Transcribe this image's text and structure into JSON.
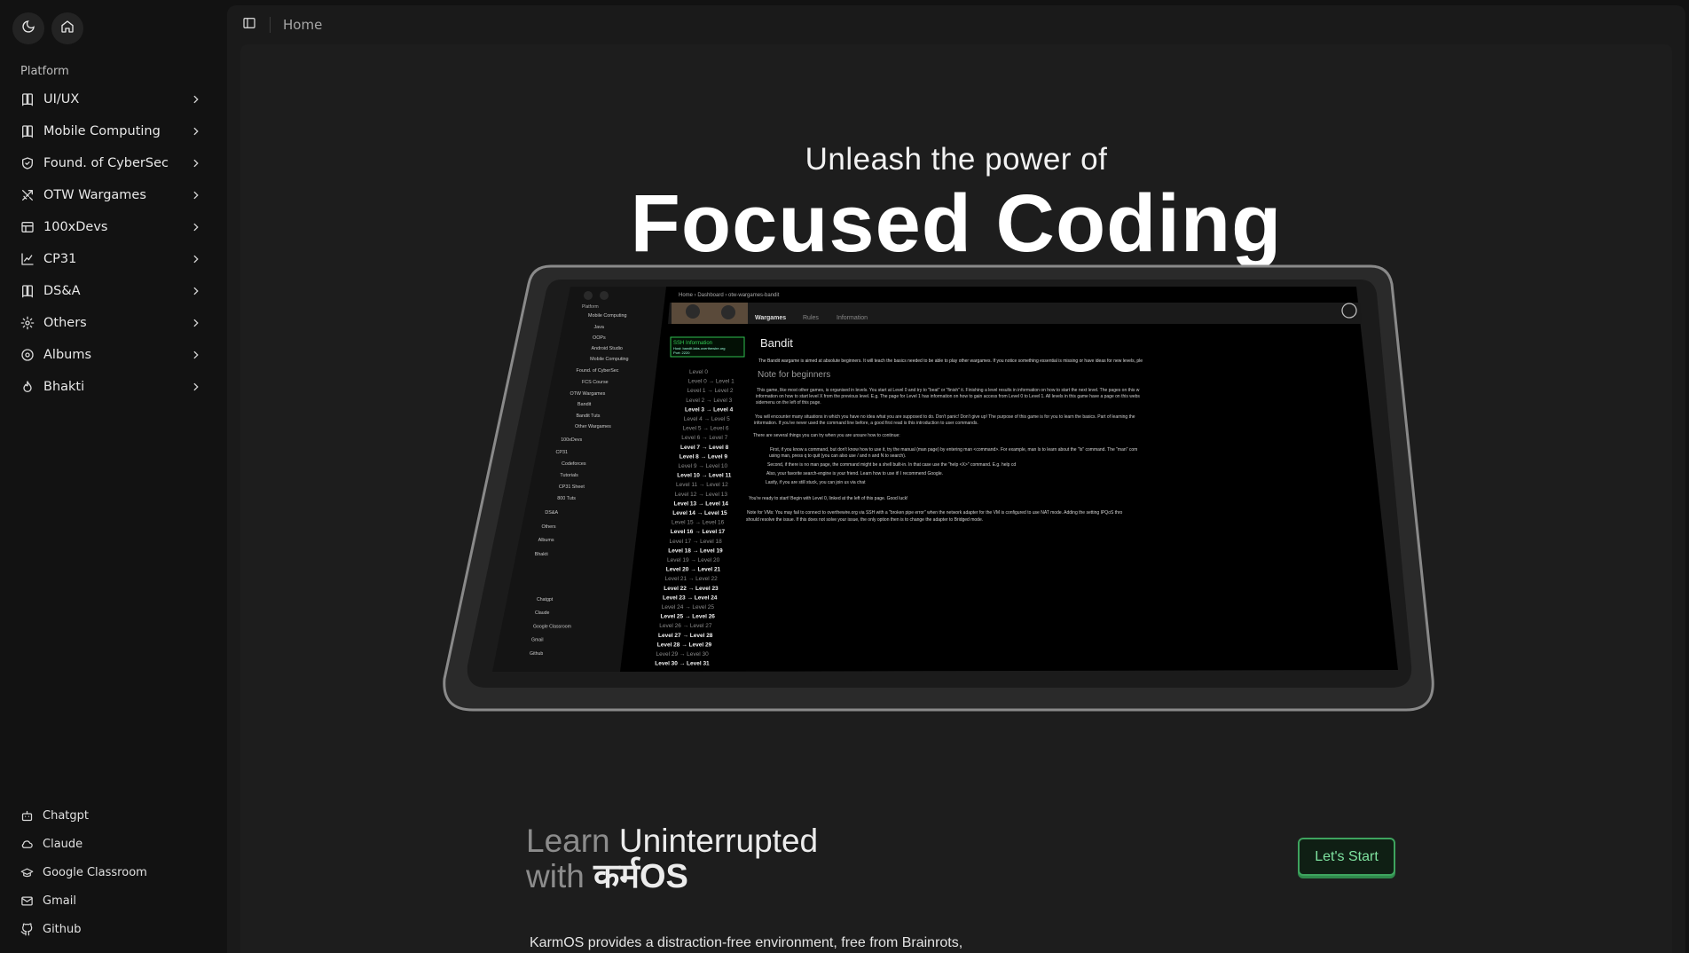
{
  "top_buttons": [
    {
      "icon": "moon-icon"
    },
    {
      "icon": "home-icon"
    }
  ],
  "sidebar": {
    "section_label": "Platform",
    "items": [
      {
        "label": "UI/UX",
        "icon": "book-icon"
      },
      {
        "label": "Mobile Computing",
        "icon": "book-icon"
      },
      {
        "label": "Found. of CyberSec",
        "icon": "shield-icon"
      },
      {
        "label": "OTW Wargames",
        "icon": "swords-icon"
      },
      {
        "label": "100xDevs",
        "icon": "table-icon"
      },
      {
        "label": "CP31",
        "icon": "chart-icon"
      },
      {
        "label": "DS&A",
        "icon": "book-icon"
      },
      {
        "label": "Others",
        "icon": "gear-icon"
      },
      {
        "label": "Albums",
        "icon": "disc-icon"
      },
      {
        "label": "Bhakti",
        "icon": "flame-icon"
      }
    ],
    "bottom_links": [
      {
        "label": "Chatgpt",
        "icon": "bot-icon"
      },
      {
        "label": "Claude",
        "icon": "cloud-icon"
      },
      {
        "label": "Google Classroom",
        "icon": "graduation-cap-icon"
      },
      {
        "label": "Gmail",
        "icon": "mail-icon"
      },
      {
        "label": "Github",
        "icon": "github-icon"
      }
    ]
  },
  "header": {
    "breadcrumb": "Home"
  },
  "hero": {
    "subtitle": "Unleash the power of",
    "title": "Focused Coding"
  },
  "preview": {
    "breadcrumb": [
      "Home",
      "Dashboard",
      "otw-wargames-bandit"
    ],
    "tabs": [
      "Wargames",
      "Rules",
      "Information"
    ],
    "ssh_title": "SSH Information",
    "ssh_host": "Host: bandit.labs.overthewire.org",
    "ssh_port": "Port: 2220",
    "page_title": "Bandit",
    "note_heading": "Note for beginners",
    "intro": "The Bandit wargame is aimed at absolute beginners. It will teach the basics needed to be able to play other wargames. If you notice something essential is missing or have ideas for new levels, ple",
    "para1": "This game, like most other games, is organised in levels. You start at Level 0 and try to \"beat\" or \"finish\" it. Finishing a level results in information on how to start the next level. The pages on this w",
    "para1b": "information on how to start level X from the previous level. E.g. The page for Level 1 has information on how to gain access from Level 0 to Level 1. All levels in this game have a page on this webs",
    "para1c": "sidemenu on the left of this page.",
    "para2": "You will encounter many situations in which you have no idea what you are supposed to do. Don't panic! Don't give up! The purpose of this game is for you to learn the basics. Part of learning the",
    "para2b": "information. If you've never used the command line before, a good first read is this introduction to user commands.",
    "para3": "There are several things you can try when you are unsure how to continue:",
    "tips": [
      "First, if you know a command, but don't know how to use it, try the manual (man page) by entering man <command>. For example, man ls to learn about the \"ls\" command. The \"man\" com",
      "using man, press q to quit (you can also use / and n and N to search).",
      "Second, if there is no man page, the command might be a shell built-in. In that case use the \"help <X>\" command. E.g. help cd",
      "Also, your favorite search-engine is your friend. Learn how to use it! I recommend Google.",
      "Lastly, if you are still stuck, you can join us via chat"
    ],
    "ready": "You're ready to start! Begin with Level 0, linked at the left of this page. Good luck!",
    "vm_note": "Note for VMs: You may fail to connect to overthewire.org via SSH with a \"broken pipe error\" when the network adapter for the VM is configured to use NAT mode. Adding the setting IPQoS thro",
    "vm_note_b": "should resolve the issue. If this does not solve your issue, the only option then is to change the adapter to Bridged mode.",
    "sidebar_label": "Platform",
    "sidebar_items": [
      "Mobile Computing",
      "Java",
      "OOPs",
      "Android Studio",
      "Mobile Computing",
      "Found. of CyberSec",
      "FCS Course",
      "OTW Wargames",
      "Bandit",
      "Bandit Tuts",
      "Other Wargames",
      "100xDevs",
      "CP31",
      "Codeforces",
      "Tutorials",
      "CP31 Sheet",
      "800 Tuts",
      "DS&A",
      "Others",
      "Albums",
      "Bhakti"
    ],
    "sidebar_bottom": [
      "Chatgpt",
      "Claude",
      "Google Classroom",
      "Gmail",
      "Github"
    ],
    "levels": [
      "Level 0",
      "Level 0 → Level 1",
      "Level 1 → Level 2",
      "Level 2 → Level 3",
      "Level 3 → Level 4",
      "Level 4 → Level 5",
      "Level 5 → Level 6",
      "Level 6 → Level 7",
      "Level 7 → Level 8",
      "Level 8 → Level 9",
      "Level 9 → Level 10",
      "Level 10 → Level 11",
      "Level 11 → Level 12",
      "Level 12 → Level 13",
      "Level 13 → Level 14",
      "Level 14 → Level 15",
      "Level 15 → Level 16",
      "Level 16 → Level 17",
      "Level 17 → Level 18",
      "Level 18 → Level 19",
      "Level 19 → Level 20",
      "Level 20 → Level 21",
      "Level 21 → Level 22",
      "Level 22 → Level 23",
      "Level 23 → Level 24",
      "Level 24 → Level 25",
      "Level 25 → Level 26",
      "Level 26 → Level 27",
      "Level 27 → Level 28",
      "Level 28 → Level 29",
      "Level 29 → Level 30",
      "Level 30 → Level 31"
    ],
    "bold_levels": [
      4,
      8,
      9,
      11,
      14,
      15,
      17,
      19,
      21,
      23,
      24,
      26,
      28,
      29,
      31
    ]
  },
  "learn": {
    "word1": "Learn",
    "word2": "Uninterrupted",
    "word3": "with",
    "brand": "कर्मOS"
  },
  "cta": {
    "label": "Let's Start"
  },
  "description": "KarmOS provides a distraction-free environment, free from Brainrots,",
  "colors": {
    "accent_green": "#3ea35e",
    "ssh_green": "#33cc55"
  }
}
